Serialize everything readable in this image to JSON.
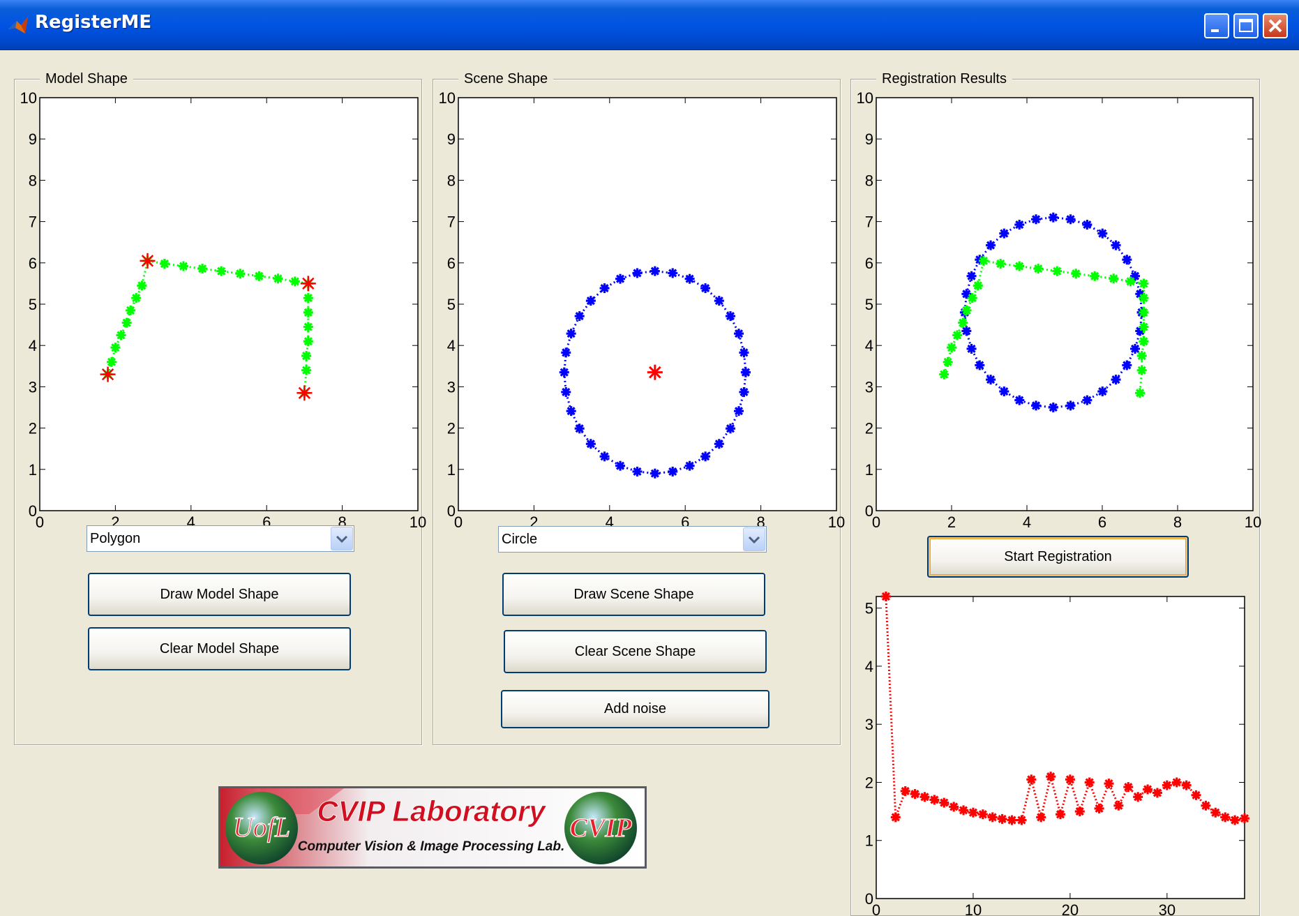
{
  "window": {
    "title": "RegisterME",
    "minimize_icon": "minimize-icon",
    "maximize_icon": "maximize-icon",
    "close_icon": "close-icon"
  },
  "model_panel": {
    "title": "Model Shape",
    "shape_select": {
      "value": "Polygon"
    },
    "draw_button": "Draw Model Shape",
    "clear_button": "Clear Model Shape"
  },
  "scene_panel": {
    "title": "Scene Shape",
    "shape_select": {
      "value": "Circle"
    },
    "draw_button": "Draw Scene Shape",
    "clear_button": "Clear Scene Shape",
    "noise_button": "Add noise"
  },
  "results_panel": {
    "title": "Registration Results",
    "start_button": "Start Registration"
  },
  "logo": {
    "title": "CVIP Laboratory",
    "subtitle": "Computer Vision & Image Processing Lab.",
    "left_badge": "UofL",
    "right_badge": "CVIP"
  },
  "colors": {
    "model": "#00ff00",
    "scene": "#0000ff",
    "marker": "#ff0000",
    "error": "#ff0000"
  },
  "chart_data": [
    {
      "id": "model",
      "type": "line",
      "xlim": [
        0,
        10
      ],
      "ylim": [
        0,
        10
      ],
      "xticks": [
        "0",
        "2",
        "4",
        "6",
        "8",
        "10"
      ],
      "yticks": [
        "0",
        "1",
        "2",
        "3",
        "4",
        "5",
        "6",
        "7",
        "8",
        "9",
        "10"
      ],
      "vertices": [
        [
          1.8,
          3.3
        ],
        [
          2.85,
          6.05
        ],
        [
          7.1,
          5.5
        ],
        [
          7.0,
          2.85
        ]
      ],
      "series": [
        {
          "values_x": [
            1.8,
            1.9,
            2.0,
            2.15,
            2.3,
            2.4,
            2.55,
            2.7,
            2.85,
            3.3,
            3.8,
            4.3,
            4.8,
            5.3,
            5.8,
            6.3,
            6.75,
            7.1,
            7.1,
            7.1,
            7.1,
            7.1,
            7.05,
            7.05,
            7.0
          ],
          "values_y": [
            3.3,
            3.6,
            3.95,
            4.25,
            4.55,
            4.85,
            5.15,
            5.45,
            6.05,
            5.98,
            5.92,
            5.86,
            5.8,
            5.74,
            5.68,
            5.62,
            5.55,
            5.5,
            5.15,
            4.8,
            4.45,
            4.1,
            3.75,
            3.4,
            2.85
          ]
        }
      ]
    },
    {
      "id": "scene",
      "type": "line",
      "xlim": [
        0,
        10
      ],
      "ylim": [
        0,
        10
      ],
      "xticks": [
        "0",
        "2",
        "4",
        "6",
        "8",
        "10"
      ],
      "yticks": [
        "0",
        "1",
        "2",
        "3",
        "4",
        "5",
        "6",
        "7",
        "8",
        "9",
        "10"
      ],
      "center": [
        5.2,
        3.35
      ],
      "radius_x": 2.4,
      "radius_y": 2.45,
      "points": 32
    },
    {
      "id": "registration",
      "type": "line",
      "xlim": [
        0,
        10
      ],
      "ylim": [
        0,
        10
      ],
      "xticks": [
        "0",
        "2",
        "4",
        "6",
        "8",
        "10"
      ],
      "yticks": [
        "0",
        "1",
        "2",
        "3",
        "4",
        "5",
        "6",
        "7",
        "8",
        "9",
        "10"
      ],
      "model_series": {
        "values_x": [
          1.8,
          1.9,
          2.0,
          2.15,
          2.3,
          2.4,
          2.55,
          2.7,
          2.85,
          3.3,
          3.8,
          4.3,
          4.8,
          5.3,
          5.8,
          6.3,
          6.75,
          7.1,
          7.1,
          7.1,
          7.1,
          7.1,
          7.05,
          7.05,
          7.0
        ],
        "values_y": [
          3.3,
          3.6,
          3.95,
          4.25,
          4.55,
          4.85,
          5.15,
          5.45,
          6.05,
          5.98,
          5.92,
          5.86,
          5.8,
          5.74,
          5.68,
          5.62,
          5.55,
          5.5,
          5.15,
          4.8,
          4.45,
          4.1,
          3.75,
          3.4,
          2.85
        ]
      },
      "scene_center": [
        4.7,
        4.8
      ],
      "scene_radius_x": 2.35,
      "scene_radius_y": 2.3,
      "scene_points": 32
    },
    {
      "id": "error",
      "type": "line",
      "xlim": [
        0,
        38
      ],
      "ylim": [
        0,
        5.2
      ],
      "xticks": [
        "0",
        "10",
        "20",
        "30"
      ],
      "yticks": [
        "0",
        "1",
        "2",
        "3",
        "4",
        "5"
      ],
      "x": [
        1,
        2,
        3,
        4,
        5,
        6,
        7,
        8,
        9,
        10,
        11,
        12,
        13,
        14,
        15,
        16,
        17,
        18,
        19,
        20,
        21,
        22,
        23,
        24,
        25,
        26,
        27,
        28,
        29,
        30,
        31,
        32,
        33,
        34,
        35,
        36,
        37,
        38
      ],
      "values": [
        5.2,
        1.4,
        1.85,
        1.8,
        1.75,
        1.7,
        1.65,
        1.58,
        1.52,
        1.48,
        1.45,
        1.4,
        1.37,
        1.35,
        1.35,
        2.05,
        1.4,
        2.1,
        1.45,
        2.05,
        1.5,
        2.0,
        1.55,
        1.98,
        1.6,
        1.92,
        1.75,
        1.88,
        1.82,
        1.95,
        2.0,
        1.95,
        1.78,
        1.6,
        1.48,
        1.4,
        1.35,
        1.38
      ]
    }
  ]
}
